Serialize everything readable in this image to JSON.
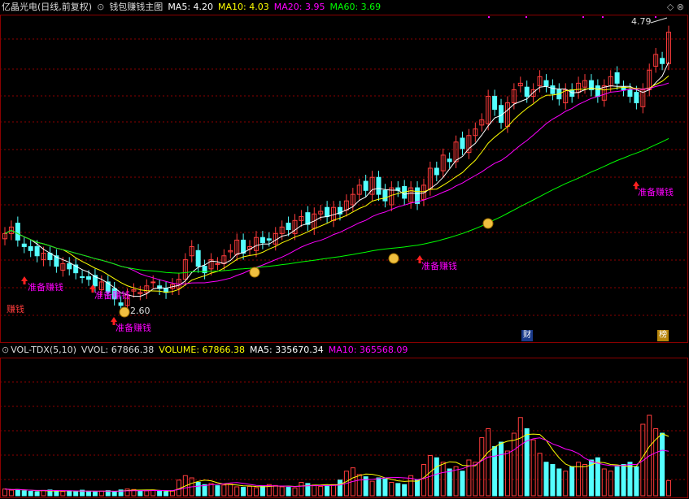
{
  "header": {
    "stock_title": "亿晶光电(日线,前复权)",
    "indicator_name": "钱包赚钱主图",
    "ma5": "MA5: 4.20",
    "ma10": "MA10: 4.03",
    "ma20": "MA20: 3.95",
    "ma60": "MA60: 3.69"
  },
  "vol_header": {
    "indicator": "VOL-TDX(5,10)",
    "vvol": "VVOL: 67866.38",
    "volume": "VOLUME: 67866.38",
    "ma5": "MA5: 335670.34",
    "ma10": "MA10: 365568.09"
  },
  "annotations": {
    "high_label": "4.79",
    "low_label": "2.60",
    "signal_label": "准备赚钱",
    "earn_label": "赚钱",
    "cai_badge": "财",
    "zhang_badge": "榜"
  },
  "colors": {
    "background": "#000000",
    "up": "#ff3c3c",
    "down": "#54ffff",
    "ma5": "#ffffff",
    "ma10": "#ffff00",
    "ma20": "#ff00ff",
    "ma60": "#00ff00",
    "grid": "#8b0000"
  },
  "chart_data": {
    "type": "candlestick",
    "title": "亿晶光电(日线,前复权)",
    "ma_values": {
      "MA5": 4.2,
      "MA10": 4.03,
      "MA20": 3.95,
      "MA60": 3.69
    },
    "price_range": [
      2.55,
      4.85
    ],
    "highest": 4.79,
    "lowest": 2.6,
    "closes": [
      3.25,
      3.3,
      3.2,
      3.15,
      3.12,
      3.08,
      3.1,
      3.05,
      3.0,
      3.02,
      2.98,
      2.95,
      2.92,
      2.9,
      2.85,
      2.88,
      2.8,
      2.75,
      2.7,
      2.78,
      2.82,
      2.8,
      2.85,
      2.88,
      2.83,
      2.8,
      2.86,
      2.9,
      3.05,
      3.15,
      3.0,
      2.95,
      3.05,
      3.02,
      3.08,
      3.12,
      3.2,
      3.1,
      3.15,
      3.22,
      3.18,
      3.2,
      3.25,
      3.3,
      3.28,
      3.35,
      3.38,
      3.32,
      3.4,
      3.42,
      3.38,
      3.45,
      3.4,
      3.5,
      3.55,
      3.62,
      3.58,
      3.68,
      3.55,
      3.5,
      3.6,
      3.58,
      3.52,
      3.6,
      3.48,
      3.62,
      3.75,
      3.7,
      3.85,
      3.8,
      3.95,
      3.9,
      4.0,
      4.05,
      4.12,
      4.3,
      4.2,
      4.1,
      4.25,
      4.35,
      4.4,
      4.3,
      4.35,
      4.45,
      4.38,
      4.32,
      4.28,
      4.35,
      4.3,
      4.4,
      4.42,
      4.35,
      4.3,
      4.38,
      4.45,
      4.4,
      4.35,
      4.3,
      4.25,
      4.35,
      4.5,
      4.62,
      4.55,
      4.79
    ],
    "volumes": [
      30000,
      25000,
      28000,
      22000,
      20000,
      18000,
      24000,
      26000,
      20000,
      19000,
      22000,
      18000,
      25000,
      20000,
      17000,
      21000,
      23000,
      19000,
      26000,
      30000,
      28000,
      24000,
      22000,
      26000,
      20000,
      18000,
      21000,
      70000,
      90000,
      80000,
      60000,
      50000,
      55000,
      45000,
      48000,
      52000,
      40000,
      38000,
      42000,
      36000,
      44000,
      50000,
      46000,
      40000,
      38000,
      35000,
      60000,
      55000,
      48000,
      42000,
      45000,
      50000,
      70000,
      110000,
      125000,
      95000,
      85000,
      65000,
      80000,
      75000,
      60000,
      55000,
      50000,
      90000,
      70000,
      140000,
      180000,
      170000,
      150000,
      120000,
      130000,
      110000,
      160000,
      150000,
      260000,
      300000,
      220000,
      240000,
      200000,
      280000,
      350000,
      300000,
      250000,
      190000,
      150000,
      140000,
      120000,
      110000,
      130000,
      150000,
      140000,
      160000,
      170000,
      120000,
      110000,
      130000,
      140000,
      150000,
      130000,
      320000,
      360000,
      300000,
      280000,
      67866
    ]
  }
}
